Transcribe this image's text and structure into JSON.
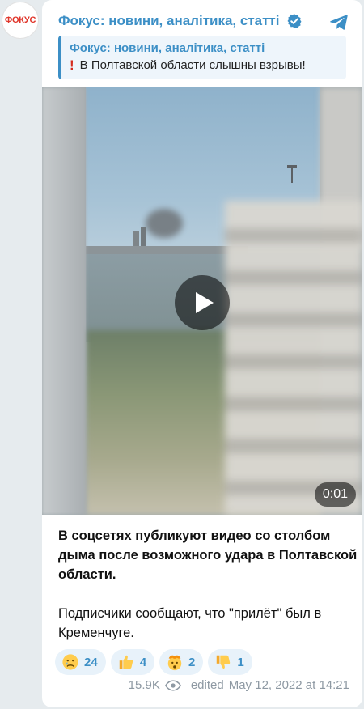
{
  "avatar": {
    "text": "ФОКУС",
    "color": "#e0362b"
  },
  "header": {
    "channel_name": "Фокус: новини, аналітика, статті",
    "verified_icon": "verified-badge-icon",
    "share_icon": "telegram-icon"
  },
  "quote": {
    "title": "Фокус: новини, аналітика, статті",
    "icon": "exclamation",
    "icon_glyph": "!",
    "text": "В Полтавской области слышны взрывы!"
  },
  "video": {
    "duration": "0:01",
    "play_icon": "play-icon"
  },
  "message": {
    "paragraph1": "В соцсетях публикуют видео со столбом дыма после возможного удара в Полтавской области.",
    "paragraph2": "Подписчики сообщают, что \"прилёт\" был в Кременчуге."
  },
  "reactions": [
    {
      "emoji": "crying-face",
      "count": "24"
    },
    {
      "emoji": "thumbs-up",
      "count": "4"
    },
    {
      "emoji": "exploding-head",
      "count": "2"
    },
    {
      "emoji": "thumbs-down",
      "count": "1"
    }
  ],
  "footer": {
    "views": "15.9K",
    "views_icon": "eye-icon",
    "edited_label": "edited",
    "date": "May 12, 2022 at 14:21"
  },
  "colors": {
    "accent": "#3c8fc6",
    "background": "#e6ebee",
    "card": "#ffffff"
  }
}
